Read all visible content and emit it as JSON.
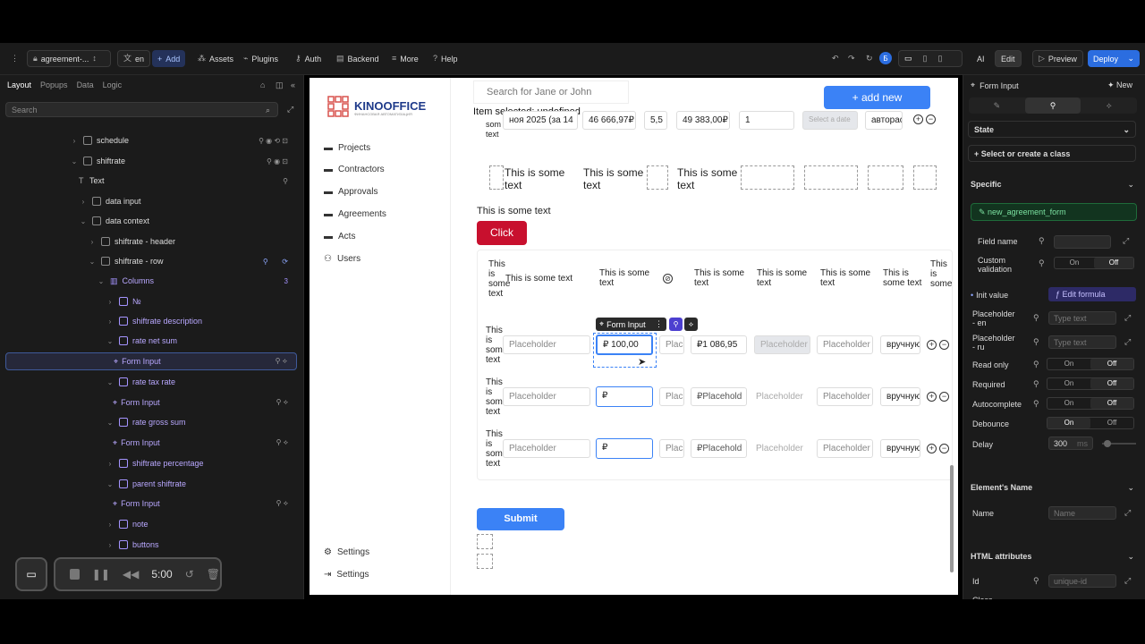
{
  "topbar": {
    "project": "agreement-...",
    "lang": "en",
    "add": "Add",
    "assets": "Assets",
    "plugins": "Plugins",
    "auth": "Auth",
    "backend": "Backend",
    "more": "More",
    "help": "Help",
    "avatar": "Б",
    "ai": "AI",
    "edit": "Edit",
    "preview": "Preview",
    "deploy": "Deploy"
  },
  "left": {
    "tabs": [
      "Layout",
      "Popups",
      "Data",
      "Logic"
    ],
    "search_placeholder": "Search",
    "tree": [
      {
        "label": "schedule"
      },
      {
        "label": "shiftrate"
      },
      {
        "label": "Text"
      },
      {
        "label": "data input"
      },
      {
        "label": "data context"
      },
      {
        "label": "shiftrate - header"
      },
      {
        "label": "shiftrate - row"
      },
      {
        "label": "Columns",
        "count": "3"
      },
      {
        "label": "№"
      },
      {
        "label": "shiftrate description"
      },
      {
        "label": "rate net sum"
      },
      {
        "label": "Form Input"
      },
      {
        "label": "rate tax rate"
      },
      {
        "label": "Form Input"
      },
      {
        "label": "rate gross sum"
      },
      {
        "label": "Form Input"
      },
      {
        "label": "shiftrate percentage"
      },
      {
        "label": "parent shiftrate"
      },
      {
        "label": "Form Input"
      },
      {
        "label": "note"
      },
      {
        "label": "buttons"
      }
    ]
  },
  "recorder": {
    "time": "5:00"
  },
  "canvas": {
    "logo": "KINOOFFICE",
    "logo_sub": "ФИНАНСОВАЯ АВТОМАТИЗАЦИЯ",
    "nav": [
      "Projects",
      "Contractors",
      "Approvals",
      "Agreements",
      "Acts",
      "Users"
    ],
    "nav_settings": [
      "Settings",
      "Settings"
    ],
    "search_placeholder": "Search for Jane or John",
    "add_new": "+ add new",
    "item_selected": "Item selected: undefined",
    "row0": {
      "c1": "ноя 2025 (за 14",
      "c2": "46 666,97₽",
      "c3": "5,5",
      "c4": "49 383,00₽",
      "c5": "1",
      "c6": "Select a date",
      "c7": "авторас",
      "c0": "som text"
    },
    "sometext": "This is some text",
    "sometext_wrapped": "This is som text",
    "click": "Click",
    "header": [
      "This is some text",
      "This is some text",
      "This is some text",
      "This is some text",
      "This is some text",
      "This is some text",
      "This is some text",
      "This is some"
    ],
    "row1": {
      "desc": "Placeholder",
      "net": "₽ 100,00",
      "tax": "Plac",
      "gross": "₽1 086,95",
      "pct": "Placeholder",
      "parent": "Placeholder",
      "note": "вручную"
    },
    "row2": {
      "desc": "Placeholder",
      "net": "₽",
      "tax": "Plac",
      "gross": "₽Placehold",
      "pct": "Placeholder",
      "parent": "Placeholder",
      "note": "вручную"
    },
    "row3": {
      "desc": "Placeholder",
      "net": "₽",
      "tax": "Plac",
      "gross": "₽Placehold",
      "pct": "Placeholder",
      "parent": "Placeholder",
      "note": "вручную"
    },
    "form_input_tag": "Form Input",
    "submit": "Submit"
  },
  "right": {
    "title": "Form Input",
    "new": "New",
    "state": "State",
    "class_select": "Select or create a class",
    "specific": "Specific",
    "form_name": "new_agreement_form",
    "field_name": "Field name",
    "custom_validation": "Custom validation",
    "init_value": "Init value",
    "edit_formula": "Edit formula",
    "placeholder_en": "Placeholder - en",
    "placeholder_ru": "Placeholder - ru",
    "type_text": "Type text",
    "read_only": "Read only",
    "required": "Required",
    "autocomplete": "Autocomplete",
    "debounce": "Debounce",
    "delay": "Delay",
    "delay_value": "300",
    "delay_unit": "ms",
    "on": "On",
    "off": "Off",
    "element_name": "Element's Name",
    "name": "Name",
    "name_placeholder": "Name",
    "html_attributes": "HTML attributes",
    "id": "Id",
    "id_placeholder": "unique-id",
    "class": "Class"
  }
}
